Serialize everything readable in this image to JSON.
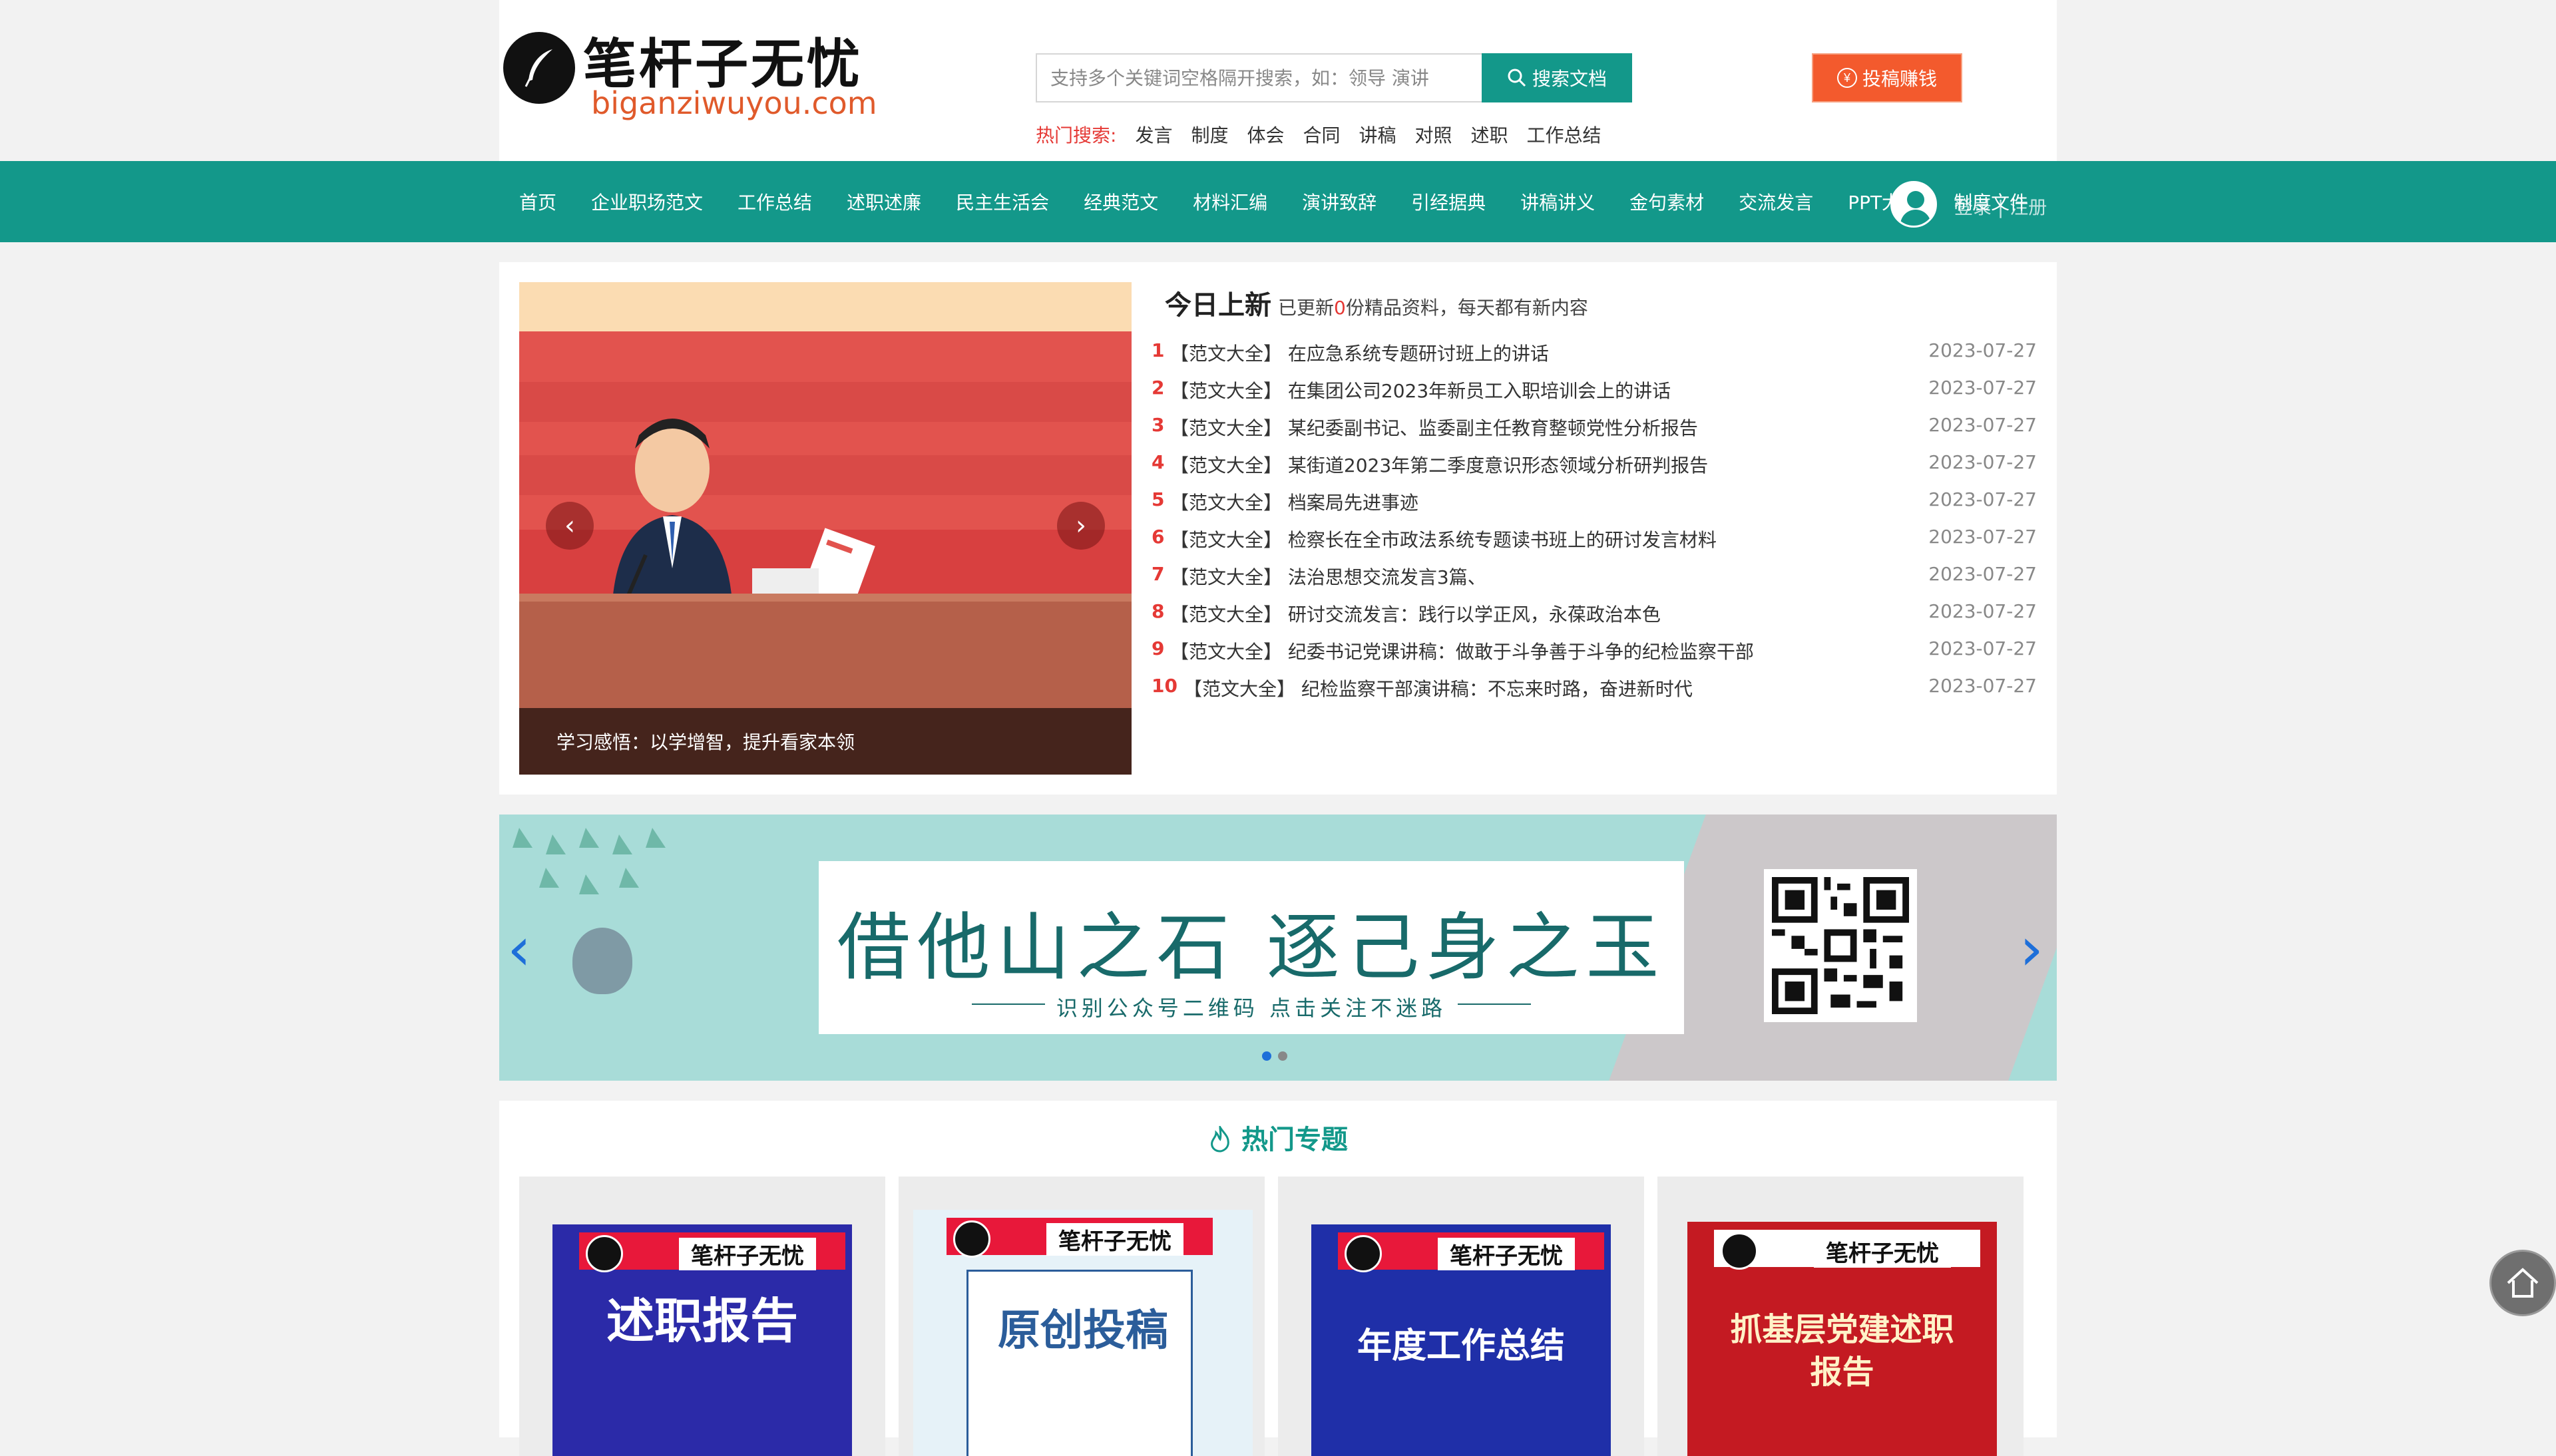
{
  "header": {
    "logo_title": "笔杆子无忧",
    "logo_domain": "biganziwuyou.com",
    "search_placeholder": "支持多个关键词空格隔开搜索，如：领导 演讲",
    "search_button": "搜索文档",
    "submit_button": "投稿赚钱",
    "hot_label": "热门搜索:",
    "hot_items": [
      "发言",
      "制度",
      "体会",
      "合同",
      "讲稿",
      "对照",
      "述职",
      "工作总结"
    ]
  },
  "nav": {
    "items": [
      "首页",
      "企业职场范文",
      "工作总结",
      "述职述廉",
      "民主生活会",
      "经典范文",
      "材料汇编",
      "演讲致辞",
      "引经据典",
      "讲稿讲义",
      "金句素材",
      "交流发言",
      "PPT大全",
      "制度文件"
    ],
    "login_text": "登录 | 注册"
  },
  "slider": {
    "caption": "学习感悟：以学增智，提升看家本领"
  },
  "news": {
    "title": "今日上新",
    "subtitle_pre": "已更新",
    "subtitle_num": "0",
    "subtitle_post": "份精品资料，每天都有新内容",
    "items": [
      {
        "num": "1",
        "title": "【范文大全】 在应急系统专题研讨班上的讲话",
        "date": "2023-07-27"
      },
      {
        "num": "2",
        "title": "【范文大全】 在集团公司2023年新员工入职培训会上的讲话",
        "date": "2023-07-27"
      },
      {
        "num": "3",
        "title": "【范文大全】 某纪委副书记、监委副主任教育整顿党性分析报告",
        "date": "2023-07-27"
      },
      {
        "num": "4",
        "title": "【范文大全】 某街道2023年第二季度意识形态领域分析研判报告",
        "date": "2023-07-27"
      },
      {
        "num": "5",
        "title": "【范文大全】 档案局先进事迹",
        "date": "2023-07-27"
      },
      {
        "num": "6",
        "title": "【范文大全】 检察长在全市政法系统专题读书班上的研讨发言材料",
        "date": "2023-07-27"
      },
      {
        "num": "7",
        "title": "【范文大全】 法治思想交流发言3篇、",
        "date": "2023-07-27"
      },
      {
        "num": "8",
        "title": "【范文大全】 研讨交流发言：践行以学正风，永葆政治本色",
        "date": "2023-07-27"
      },
      {
        "num": "9",
        "title": "【范文大全】 纪委书记党课讲稿：做敢于斗争善于斗争的纪检监察干部",
        "date": "2023-07-27"
      },
      {
        "num": "10",
        "title": "【范文大全】 纪检监察干部演讲稿：不忘来时路，奋进新时代",
        "date": "2023-07-27"
      }
    ]
  },
  "banner": {
    "title": "借他山之石  逐己身之玉",
    "subtitle": "识别公众号二维码        点击关注不迷路"
  },
  "topics": {
    "title": "热门专题",
    "cards": [
      {
        "tag": "笔杆子无忧",
        "main": "述职报告"
      },
      {
        "tag": "笔杆子无忧",
        "main": "原创投稿"
      },
      {
        "tag": "笔杆子无忧",
        "main": "年度工作总结"
      },
      {
        "tag": "笔杆子无忧",
        "main": "抓基层党建述职报告"
      }
    ]
  },
  "colors": {
    "brand_teal": "#13988a",
    "accent_orange": "#f35a2d",
    "hot_red": "#e53935"
  }
}
